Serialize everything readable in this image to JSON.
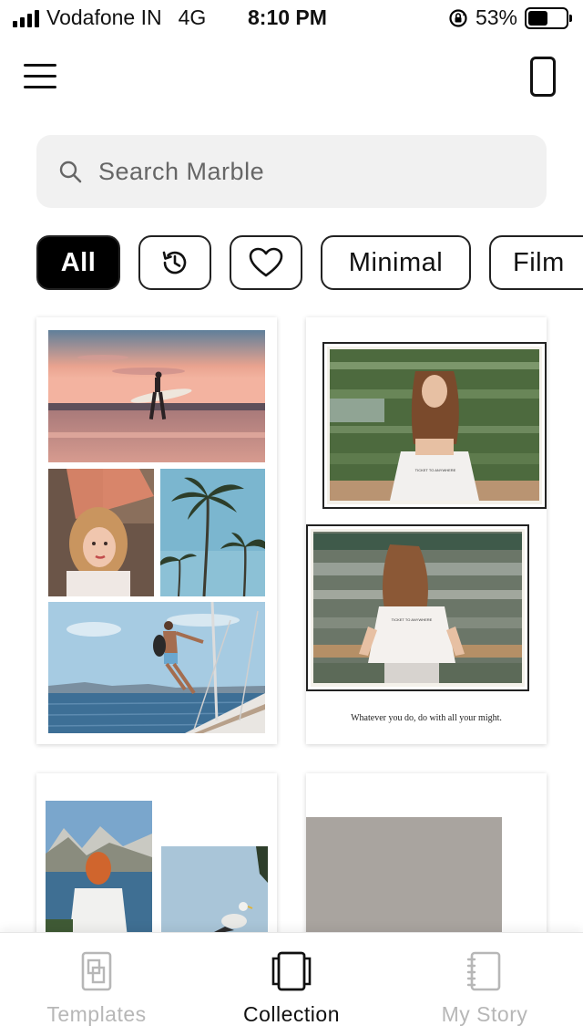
{
  "status_bar": {
    "carrier": "Vodafone IN",
    "network": "4G",
    "time": "8:10 PM",
    "battery": "53%",
    "battery_level": 0.53
  },
  "header": {
    "menu_icon": "hamburger-menu-icon",
    "device_icon": "phone-preview-icon"
  },
  "search": {
    "placeholder": "Search Marble",
    "value": ""
  },
  "filters": {
    "all_label": "All",
    "recent_icon": "history-icon",
    "favorites_icon": "heart-icon",
    "minimal_label": "Minimal",
    "film_label": "Film"
  },
  "templates": {
    "film_caption": "Whatever you do, do with all your might.",
    "tshirt_text": "TICKET TO ANYWHERE"
  },
  "bottom_nav": {
    "templates_label": "Templates",
    "collection_label": "Collection",
    "my_story_label": "My Story"
  },
  "colors": {
    "active_chip": "#000000",
    "inactive_nav": "#b7b7b7",
    "search_bg": "#f1f1f1"
  }
}
